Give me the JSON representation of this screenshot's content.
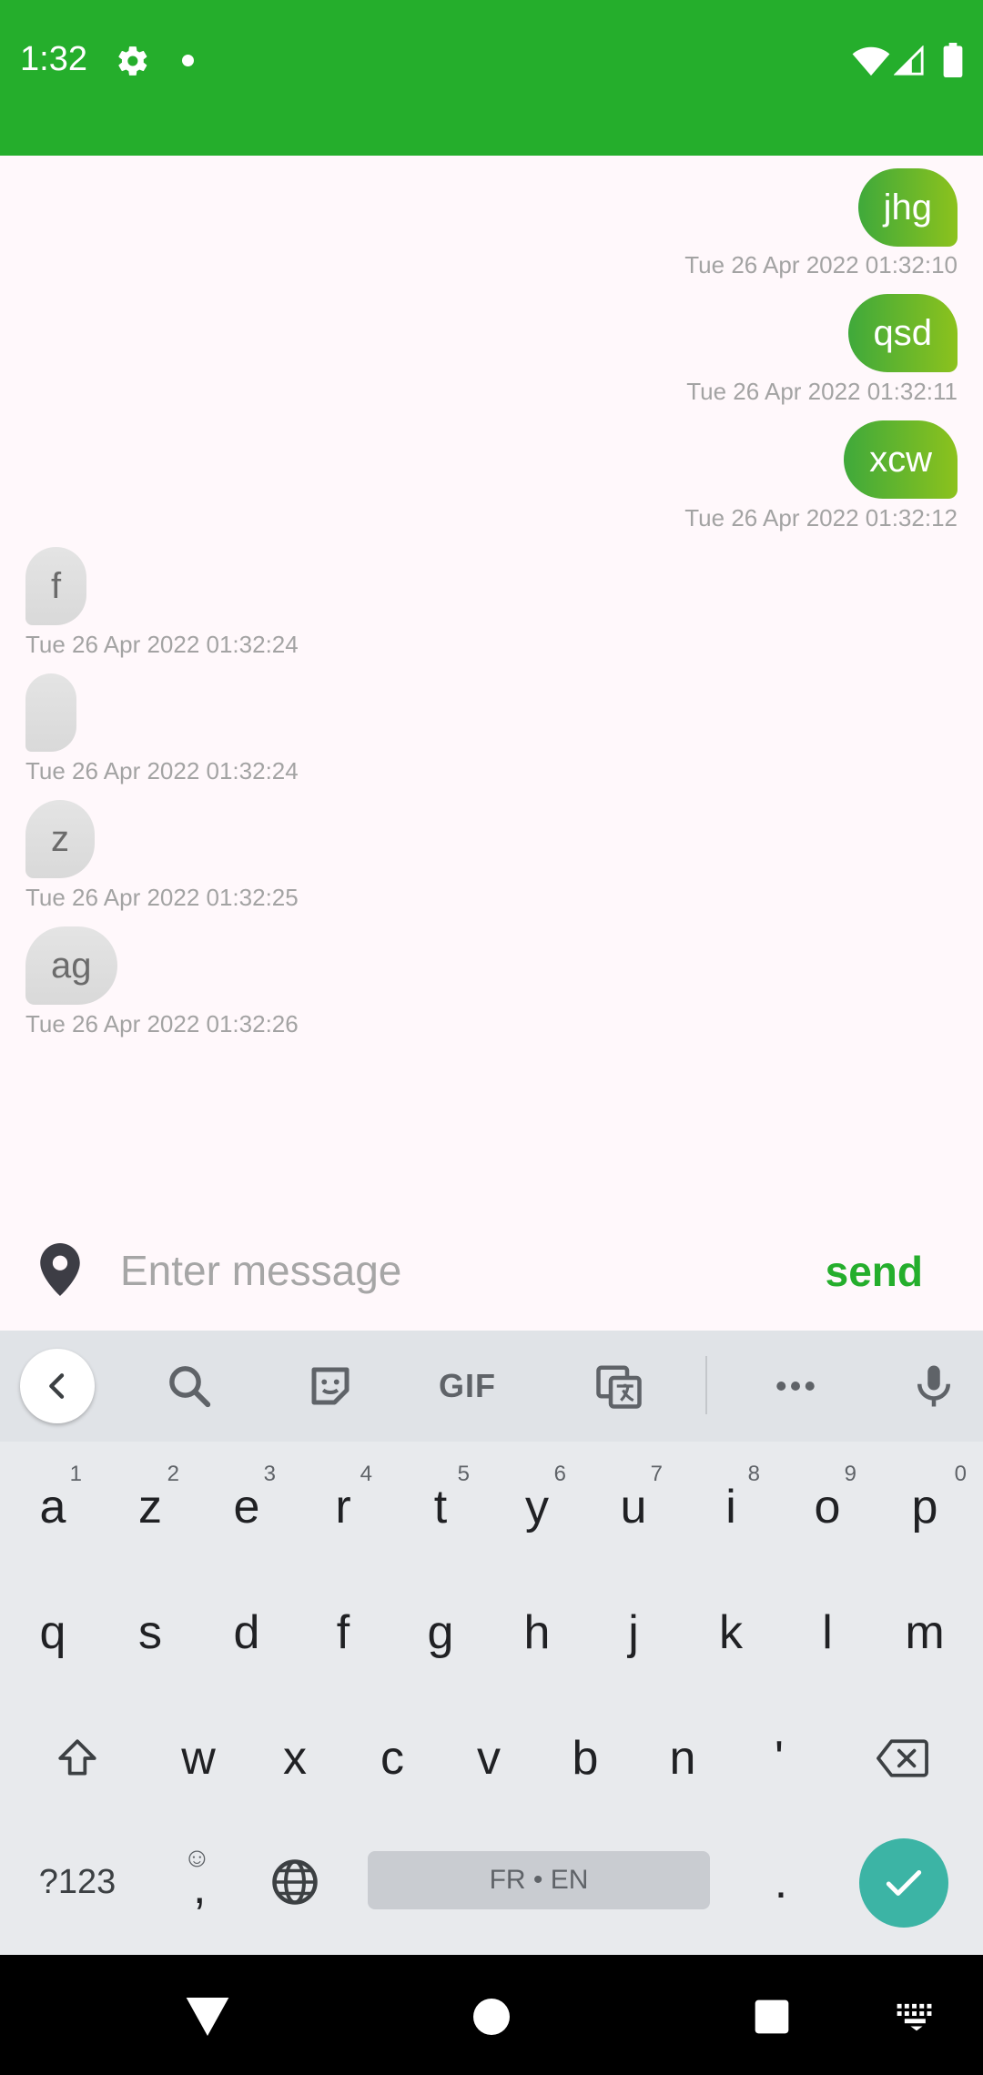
{
  "status_bar": {
    "time": "1:32",
    "icons": [
      "gear-icon",
      "notification-dot-icon",
      "wifi-icon",
      "signal-icon",
      "battery-icon"
    ],
    "color": "#25ae2c"
  },
  "messages": [
    {
      "direction": "out",
      "text": "jhg",
      "timestamp": "Tue 26 Apr 2022 01:32:10"
    },
    {
      "direction": "out",
      "text": "qsd",
      "timestamp": "Tue 26 Apr 2022 01:32:11"
    },
    {
      "direction": "out",
      "text": "xcw",
      "timestamp": "Tue 26 Apr 2022 01:32:12"
    },
    {
      "direction": "in",
      "text": "f",
      "timestamp": "Tue 26 Apr 2022 01:32:24"
    },
    {
      "direction": "in",
      "text": "",
      "timestamp": "Tue 26 Apr 2022 01:32:24"
    },
    {
      "direction": "in",
      "text": "z",
      "timestamp": "Tue 26 Apr 2022 01:32:25"
    },
    {
      "direction": "in",
      "text": "ag",
      "timestamp": "Tue 26 Apr 2022 01:32:26"
    }
  ],
  "composer": {
    "placeholder": "Enter message",
    "value": "",
    "send_label": "send",
    "location_icon": "location-pin-icon"
  },
  "keyboard": {
    "toolbar": {
      "back_icon": "chevron-left-icon",
      "search_icon": "search-icon",
      "sticker_icon": "sticker-icon",
      "gif_label": "GIF",
      "translate_icon": "translate-icon",
      "more_icon": "more-icon",
      "mic_icon": "microphone-icon"
    },
    "row1": [
      {
        "key": "a",
        "hint": "1"
      },
      {
        "key": "z",
        "hint": "2"
      },
      {
        "key": "e",
        "hint": "3"
      },
      {
        "key": "r",
        "hint": "4"
      },
      {
        "key": "t",
        "hint": "5"
      },
      {
        "key": "y",
        "hint": "6"
      },
      {
        "key": "u",
        "hint": "7"
      },
      {
        "key": "i",
        "hint": "8"
      },
      {
        "key": "o",
        "hint": "9"
      },
      {
        "key": "p",
        "hint": "0"
      }
    ],
    "row2": [
      "q",
      "s",
      "d",
      "f",
      "g",
      "h",
      "j",
      "k",
      "l",
      "m"
    ],
    "row3": [
      "w",
      "x",
      "c",
      "v",
      "b",
      "n",
      "'"
    ],
    "symbols_label": "?123",
    "comma_label": ",",
    "space_label": "FR • EN",
    "period_label": ".",
    "accent_color": "#3cb4a5"
  },
  "nav_bar": {
    "icons": [
      "back-triangle-icon",
      "home-circle-icon",
      "recents-square-icon",
      "keyboard-icon"
    ]
  }
}
